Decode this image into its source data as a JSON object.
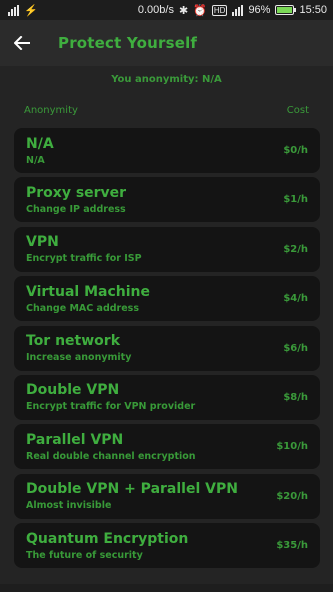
{
  "status_bar": {
    "speed": "0.00b/s",
    "battery_percent": "96%",
    "time": "15:50",
    "battery_level": 0.96,
    "icons": [
      "sim-icon",
      "usb-icon",
      "bluetooth-icon",
      "alarm-icon",
      "hd-icon",
      "signal-icon",
      "battery-icon"
    ]
  },
  "app_bar": {
    "title": "Protect Yourself",
    "back_icon": "arrow-left-icon"
  },
  "anonymity_status": "You anonymity: N/A",
  "columns": {
    "left": "Anonymity",
    "right": "Cost"
  },
  "items": [
    {
      "name": "N/A",
      "desc": "N/A",
      "cost": "$0/h"
    },
    {
      "name": "Proxy server",
      "desc": "Change IP address",
      "cost": "$1/h"
    },
    {
      "name": "VPN",
      "desc": "Encrypt traffic for ISP",
      "cost": "$2/h"
    },
    {
      "name": "Virtual Machine",
      "desc": "Change MAC address",
      "cost": "$4/h"
    },
    {
      "name": "Tor network",
      "desc": "Increase anonymity",
      "cost": "$6/h"
    },
    {
      "name": "Double VPN",
      "desc": "Encrypt traffic for VPN provider",
      "cost": "$8/h"
    },
    {
      "name": "Parallel VPN",
      "desc": "Real double channel encryption",
      "cost": "$10/h"
    },
    {
      "name": "Double VPN + Parallel VPN",
      "desc": "Almost invisible",
      "cost": "$20/h"
    },
    {
      "name": "Quantum Encryption",
      "desc": "The future of security",
      "cost": "$35/h"
    }
  ],
  "colors": {
    "accent": "#3fae3f",
    "background": "#242424",
    "card": "#141414"
  }
}
